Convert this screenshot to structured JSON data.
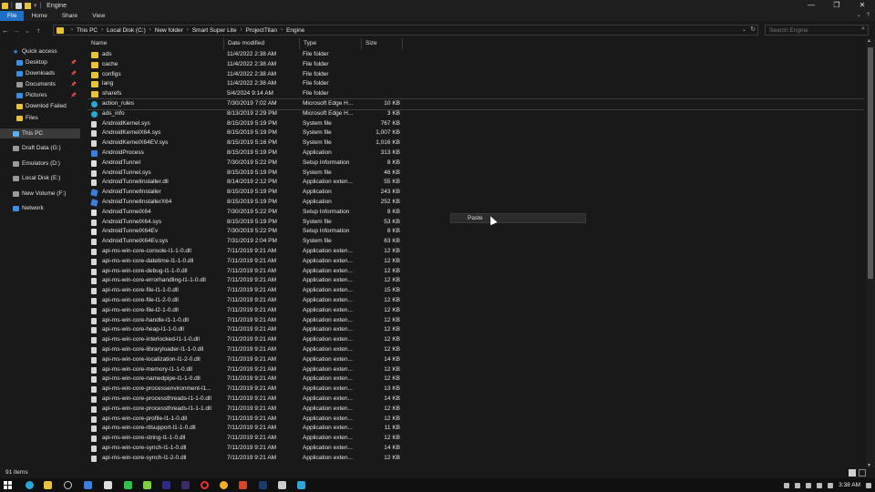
{
  "window": {
    "title": "Engine",
    "controls": {
      "minimize": "—",
      "maximize": "❐",
      "close": "✕"
    }
  },
  "ribbon": {
    "tabs": [
      "File",
      "Home",
      "Share",
      "View"
    ],
    "active": "File"
  },
  "address": {
    "crumbs": [
      "This PC",
      "Local Disk (C:)",
      "New folder",
      "Smart Super Lite",
      "ProjectTitan",
      "Engine"
    ],
    "search_placeholder": "Search Engine"
  },
  "nav": {
    "items": [
      {
        "label": "Quick access",
        "icon": "star-icon",
        "kind": "star"
      },
      {
        "label": "Desktop",
        "icon": "desktop-icon",
        "kind": "blue",
        "pinned": true
      },
      {
        "label": "Downloads",
        "icon": "download-icon",
        "kind": "blue",
        "pinned": true
      },
      {
        "label": "Documents",
        "icon": "document-icon",
        "kind": "gray",
        "pinned": true
      },
      {
        "label": "Pictures",
        "icon": "pictures-icon",
        "kind": "blue",
        "pinned": true
      },
      {
        "label": "Downlod Failed",
        "icon": "folder-icon",
        "kind": "yellow"
      },
      {
        "label": "Files",
        "icon": "folder-icon",
        "kind": "yellow"
      },
      {
        "label": "This PC",
        "icon": "computer-icon",
        "kind": "pc",
        "selected": true
      },
      {
        "label": "Draft Data (G:)",
        "icon": "drive-icon",
        "kind": "gray"
      },
      {
        "label": "Emulators (D:)",
        "icon": "drive-icon",
        "kind": "gray"
      },
      {
        "label": "Local Disk (E:)",
        "icon": "drive-icon",
        "kind": "gray"
      },
      {
        "label": "New Volume (F:)",
        "icon": "drive-icon",
        "kind": "gray"
      },
      {
        "label": "Network",
        "icon": "network-icon",
        "kind": "blue"
      }
    ]
  },
  "columns": {
    "name": "Name",
    "date": "Date modified",
    "type": "Type",
    "size": "Size"
  },
  "files": [
    {
      "name": "ads",
      "date": "11/4/2022 2:38 AM",
      "type": "File folder",
      "size": "",
      "icon": "folder"
    },
    {
      "name": "cache",
      "date": "11/4/2022 2:38 AM",
      "type": "File folder",
      "size": "",
      "icon": "folder"
    },
    {
      "name": "configs",
      "date": "11/4/2022 2:38 AM",
      "type": "File folder",
      "size": "",
      "icon": "folder"
    },
    {
      "name": "lang",
      "date": "11/4/2022 2:38 AM",
      "type": "File folder",
      "size": "",
      "icon": "folder"
    },
    {
      "name": "sharefs",
      "date": "5/4/2024 9:14 AM",
      "type": "File folder",
      "size": "",
      "icon": "folder"
    },
    {
      "name": "action_rules",
      "date": "7/30/2019 7:02 AM",
      "type": "Microsoft Edge H...",
      "size": "10 KB",
      "icon": "edge",
      "highlight": true
    },
    {
      "name": "ads_info",
      "date": "8/13/2019 2:29 PM",
      "type": "Microsoft Edge H...",
      "size": "3 KB",
      "icon": "edge"
    },
    {
      "name": "AndroidKernel.sys",
      "date": "8/15/2019 5:19 PM",
      "type": "System file",
      "size": "767 KB",
      "icon": "sys"
    },
    {
      "name": "AndroidKernelX64.sys",
      "date": "8/15/2019 5:19 PM",
      "type": "System file",
      "size": "1,007 KB",
      "icon": "sys"
    },
    {
      "name": "AndroidKernelX64EV.sys",
      "date": "8/15/2019 5:16 PM",
      "type": "System file",
      "size": "1,016 KB",
      "icon": "sys"
    },
    {
      "name": "AndroidProcess",
      "date": "8/15/2019 5:19 PM",
      "type": "Application",
      "size": "313 KB",
      "icon": "app"
    },
    {
      "name": "AndroidTunnel",
      "date": "7/30/2019 5:22 PM",
      "type": "Setup Information",
      "size": "8 KB",
      "icon": "setup"
    },
    {
      "name": "AndroidTunnel.sys",
      "date": "8/15/2019 5:19 PM",
      "type": "System file",
      "size": "46 KB",
      "icon": "sys"
    },
    {
      "name": "AndroidTunnelInstaller.dll",
      "date": "8/14/2019 2:12 PM",
      "type": "Application exten...",
      "size": "55 KB",
      "icon": "dll"
    },
    {
      "name": "AndroidTunnelInstaller",
      "date": "8/15/2019 5:19 PM",
      "type": "Application",
      "size": "243 KB",
      "icon": "apx"
    },
    {
      "name": "AndroidTunnelInstallerX64",
      "date": "8/15/2019 5:19 PM",
      "type": "Application",
      "size": "252 KB",
      "icon": "apx"
    },
    {
      "name": "AndroidTunnelX64",
      "date": "7/30/2019 5:22 PM",
      "type": "Setup Information",
      "size": "8 KB",
      "icon": "setup"
    },
    {
      "name": "AndroidTunnelX64.sys",
      "date": "8/15/2019 5:19 PM",
      "type": "System file",
      "size": "53 KB",
      "icon": "sys"
    },
    {
      "name": "AndroidTunnelX64Ev",
      "date": "7/30/2019 5:22 PM",
      "type": "Setup Information",
      "size": "8 KB",
      "icon": "setup"
    },
    {
      "name": "AndroidTunnelX64Ev.sys",
      "date": "7/31/2019 2:04 PM",
      "type": "System file",
      "size": "63 KB",
      "icon": "sys"
    },
    {
      "name": "api-ms-win-core-console-l1-1-0.dll",
      "date": "7/11/2019 9:21 AM",
      "type": "Application exten...",
      "size": "12 KB",
      "icon": "dll"
    },
    {
      "name": "api-ms-win-core-datetime-l1-1-0.dll",
      "date": "7/11/2019 9:21 AM",
      "type": "Application exten...",
      "size": "12 KB",
      "icon": "dll"
    },
    {
      "name": "api-ms-win-core-debug-l1-1-0.dll",
      "date": "7/11/2019 9:21 AM",
      "type": "Application exten...",
      "size": "12 KB",
      "icon": "dll"
    },
    {
      "name": "api-ms-win-core-errorhandling-l1-1-0.dll",
      "date": "7/11/2019 9:21 AM",
      "type": "Application exten...",
      "size": "12 KB",
      "icon": "dll"
    },
    {
      "name": "api-ms-win-core-file-l1-1-0.dll",
      "date": "7/11/2019 9:21 AM",
      "type": "Application exten...",
      "size": "15 KB",
      "icon": "dll"
    },
    {
      "name": "api-ms-win-core-file-l1-2-0.dll",
      "date": "7/11/2019 9:21 AM",
      "type": "Application exten...",
      "size": "12 KB",
      "icon": "dll"
    },
    {
      "name": "api-ms-win-core-file-l2-1-0.dll",
      "date": "7/11/2019 9:21 AM",
      "type": "Application exten...",
      "size": "12 KB",
      "icon": "dll"
    },
    {
      "name": "api-ms-win-core-handle-l1-1-0.dll",
      "date": "7/11/2019 9:21 AM",
      "type": "Application exten...",
      "size": "12 KB",
      "icon": "dll"
    },
    {
      "name": "api-ms-win-core-heap-l1-1-0.dll",
      "date": "7/11/2019 9:21 AM",
      "type": "Application exten...",
      "size": "12 KB",
      "icon": "dll"
    },
    {
      "name": "api-ms-win-core-interlocked-l1-1-0.dll",
      "date": "7/11/2019 9:21 AM",
      "type": "Application exten...",
      "size": "12 KB",
      "icon": "dll"
    },
    {
      "name": "api-ms-win-core-libraryloader-l1-1-0.dll",
      "date": "7/11/2019 9:21 AM",
      "type": "Application exten...",
      "size": "12 KB",
      "icon": "dll"
    },
    {
      "name": "api-ms-win-core-localization-l1-2-0.dll",
      "date": "7/11/2019 9:21 AM",
      "type": "Application exten...",
      "size": "14 KB",
      "icon": "dll"
    },
    {
      "name": "api-ms-win-core-memory-l1-1-0.dll",
      "date": "7/11/2019 9:21 AM",
      "type": "Application exten...",
      "size": "12 KB",
      "icon": "dll"
    },
    {
      "name": "api-ms-win-core-namedpipe-l1-1-0.dll",
      "date": "7/11/2019 9:21 AM",
      "type": "Application exten...",
      "size": "12 KB",
      "icon": "dll"
    },
    {
      "name": "api-ms-win-core-processenvironment-l1...",
      "date": "7/11/2019 9:21 AM",
      "type": "Application exten...",
      "size": "13 KB",
      "icon": "dll"
    },
    {
      "name": "api-ms-win-core-processthreads-l1-1-0.dll",
      "date": "7/11/2019 9:21 AM",
      "type": "Application exten...",
      "size": "14 KB",
      "icon": "dll"
    },
    {
      "name": "api-ms-win-core-processthreads-l1-1-1.dll",
      "date": "7/11/2019 9:21 AM",
      "type": "Application exten...",
      "size": "12 KB",
      "icon": "dll"
    },
    {
      "name": "api-ms-win-core-profile-l1-1-0.dll",
      "date": "7/11/2019 9:21 AM",
      "type": "Application exten...",
      "size": "12 KB",
      "icon": "dll"
    },
    {
      "name": "api-ms-win-core-rtlsupport-l1-1-0.dll",
      "date": "7/11/2019 9:21 AM",
      "type": "Application exten...",
      "size": "11 KB",
      "icon": "dll"
    },
    {
      "name": "api-ms-win-core-string-l1-1-0.dll",
      "date": "7/11/2019 9:21 AM",
      "type": "Application exten...",
      "size": "12 KB",
      "icon": "dll"
    },
    {
      "name": "api-ms-win-core-synch-l1-1-0.dll",
      "date": "7/11/2019 9:21 AM",
      "type": "Application exten...",
      "size": "14 KB",
      "icon": "dll"
    },
    {
      "name": "api-ms-win-core-synch-l1-2-0.dll",
      "date": "7/11/2019 9:21 AM",
      "type": "Application exten...",
      "size": "12 KB",
      "icon": "dll"
    }
  ],
  "context_menu": {
    "paste": "Paste"
  },
  "status": {
    "count": "91 items"
  },
  "taskbar": {
    "time": "3:38 AM"
  },
  "colors": {
    "accent": "#1f6fc5",
    "folder": "#e8c33a",
    "background": "#191919"
  }
}
